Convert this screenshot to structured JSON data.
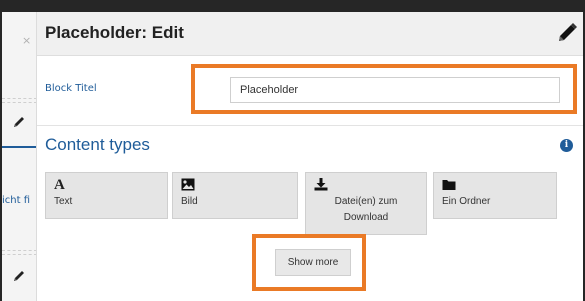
{
  "background_page": {
    "close_symbol": "×",
    "snippet_text": "icht fi"
  },
  "modal": {
    "title": "Placeholder: Edit",
    "header_icon": "pencil-icon"
  },
  "form": {
    "block_title_label": "Block Titel",
    "block_title_value": "Placeholder"
  },
  "content_types": {
    "heading": "Content types",
    "info_symbol": "i",
    "tiles": [
      {
        "icon": "text-icon",
        "glyph": "A",
        "label": "Text"
      },
      {
        "icon": "image-icon",
        "label": "Bild"
      },
      {
        "icon": "download-icon",
        "label": "Datei(en) zum Download"
      },
      {
        "icon": "folder-icon",
        "label": "Ein Ordner"
      }
    ],
    "show_more_label": "Show more"
  },
  "colors": {
    "accent_blue": "#1f5c99",
    "highlight_orange": "#ea7a26",
    "tile_bg": "#e5e5e5",
    "header_bg": "#f0f0f0"
  }
}
